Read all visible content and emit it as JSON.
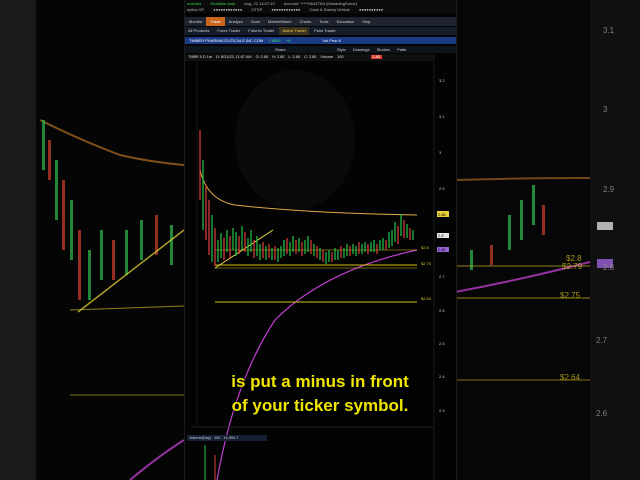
{
  "topbar": {
    "row1": [
      "nnected",
      "Realtime data",
      "Aug. 21",
      "14:07:10",
      "Account:",
      "*****0844TDA (IhstradingSorne)"
    ],
    "row2": [
      "eption SF",
      "●●●●●●●●●●●●",
      "OTSP",
      "●●●●●●●●●●●●",
      "Cash & Sweep Vehicle",
      "●●●●●●●●●●"
    ]
  },
  "tabs": [
    "Monitor",
    "Trade",
    "Analyze",
    "Scan",
    "MarketWatch",
    "Charts",
    "Tools",
    "Education",
    "Help"
  ],
  "active_tab": "Trade",
  "workspace_buttons": [
    "All Products",
    "Forex Trader",
    "Futures Trader",
    "Active Trader",
    "Pairs Trader"
  ],
  "symbol_bar": {
    "company": "TIMBER PHARMACEUTICALS INC COM",
    "price": "2.8505",
    "change": "+0.",
    "label": "Vol Proc 8"
  },
  "toolbar": [
    "Share",
    "Style",
    "Drawings",
    "Studies",
    "Patte"
  ],
  "ohlc_row": {
    "symbol": "TMBR 5 D 1m",
    "date": "D: 8/21/23, 11:57 AM",
    "open": "O: 2.85",
    "high": "H: 2.85",
    "low": "L: 2.85",
    "close": "C: 2.85",
    "volume_label": "Volume",
    "volume_value": "100",
    "badge": "2.85"
  },
  "price_axis": [
    "3.2",
    "3.1",
    "3",
    "2.9",
    "2.8",
    "2.7",
    "2.6",
    "2.5",
    "2.4",
    "2.3"
  ],
  "price_tags": [
    "2.86",
    "2.8",
    "2.81"
  ],
  "level_labels": [
    "$2.8",
    "$2.75",
    "$2.64"
  ],
  "volume_bar": {
    "label": "Volume(Day)",
    "value1": "100",
    "value2": "14,990.7"
  },
  "bg_axis": [
    "3.1",
    "3",
    "2.9",
    "2.8",
    "2.7",
    "2.6"
  ],
  "bg_levels": [
    "$2.8",
    "$2.79",
    "$2.75",
    "$2.64"
  ],
  "caption": {
    "line1": "is put a minus in front",
    "line2": "of your ticker symbol."
  },
  "colors": {
    "bull_candle": "#22c744",
    "bear_candle": "#e2403a",
    "moving_average_fast": "#e0a84a",
    "moving_average_slow": "#c13ed0",
    "level_line": "#d6c21a",
    "trendline": "#f2e14a",
    "caption_text": "#f1e600"
  }
}
